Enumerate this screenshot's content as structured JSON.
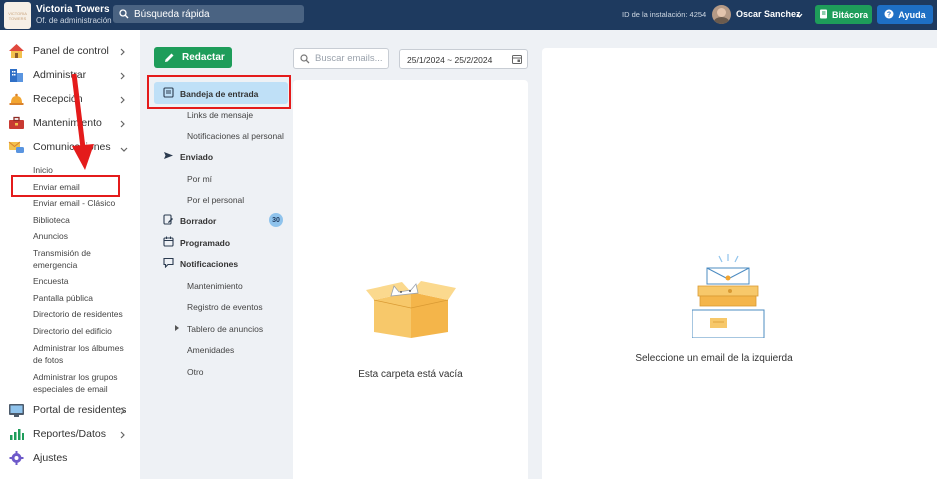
{
  "topbar": {
    "org_name": "Victoria Towers",
    "org_sub": "Of. de administración",
    "logo_text": "VICTORIA TOWERS",
    "quick_search": "Búsqueda rápida",
    "install_id": "ID de la instalación: 4254",
    "user_name": "Oscar Sanchez",
    "bitacora_label": "Bitácora",
    "ayuda_label": "Ayuda"
  },
  "sidebar": {
    "items": [
      {
        "label": "Panel de control",
        "icon": "house-icon"
      },
      {
        "label": "Administrar",
        "icon": "building-icon"
      },
      {
        "label": "Recepción",
        "icon": "bell-icon"
      },
      {
        "label": "Mantenimiento",
        "icon": "toolbox-icon"
      },
      {
        "label": "Comunicaciones",
        "icon": "mail-chat-icon"
      }
    ],
    "sub_items": [
      "Inicio",
      "Enviar email",
      "Enviar email - Clásico",
      "Biblioteca",
      "Anuncios",
      "Transmisión de emergencia",
      "Encuesta",
      "Pantalla pública",
      "Directorio de residentes",
      "Directorio del edificio",
      "Administrar los álbumes de fotos",
      "Administrar los grupos especiales de email"
    ],
    "bottom_items": [
      {
        "label": "Portal de residentes",
        "icon": "portal-icon"
      },
      {
        "label": "Reportes/Datos",
        "icon": "bar-chart-icon"
      },
      {
        "label": "Ajustes",
        "icon": "gear-icon"
      }
    ]
  },
  "folders": {
    "compose_label": "Redactar",
    "inbox": "Bandeja de entrada",
    "links": "Links de mensaje",
    "staff_notifications": "Notificaciones al personal",
    "sent": "Enviado",
    "by_me": "Por mí",
    "by_staff": "Por el personal",
    "drafts": "Borrador",
    "drafts_count": "30",
    "scheduled": "Programado",
    "notifications": "Notificaciones",
    "maintenance": "Mantenimiento",
    "event_log": "Registro de eventos",
    "bulletin": "Tablero de anuncios",
    "amenities": "Amenidades",
    "other": "Otro"
  },
  "list": {
    "search_placeholder": "Buscar emails...",
    "date_range": "25/1/2024 ~ 25/2/2024",
    "empty_text": "Esta carpeta está vacía"
  },
  "preview": {
    "placeholder_text": "Seleccione un email de la izquierda"
  },
  "colors": {
    "topbar": "#1e3a5f",
    "green": "#1e9d5a",
    "blue": "#1e6fc4",
    "selected": "#bfe0f7",
    "annotation": "#e41b1b"
  }
}
